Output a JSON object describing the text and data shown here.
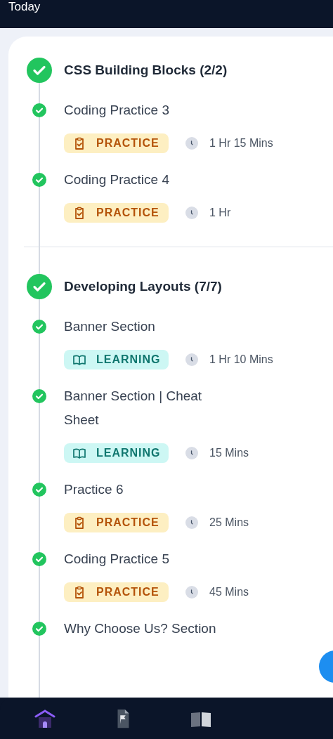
{
  "header": {
    "title": "Today"
  },
  "sections": [
    {
      "title": "CSS Building Blocks (2/2)",
      "completed": true,
      "items": [
        {
          "title": "Coding Practice 3",
          "completed": true,
          "kind": "practice",
          "tag": "PRACTICE",
          "duration": "1 Hr 15 Mins"
        },
        {
          "title": "Coding Practice 4",
          "completed": true,
          "kind": "practice",
          "tag": "PRACTICE",
          "duration": "1 Hr"
        }
      ]
    },
    {
      "title": "Developing Layouts (7/7)",
      "completed": true,
      "items": [
        {
          "title": "Banner Section",
          "completed": true,
          "kind": "learning",
          "tag": "LEARNING",
          "duration": "1 Hr 10 Mins"
        },
        {
          "title": "Banner Section | Cheat Sheet",
          "completed": true,
          "kind": "learning",
          "tag": "LEARNING",
          "duration": "15 Mins"
        },
        {
          "title": "Practice 6",
          "completed": true,
          "kind": "practice",
          "tag": "PRACTICE",
          "duration": "25 Mins"
        },
        {
          "title": "Coding Practice 5",
          "completed": true,
          "kind": "practice",
          "tag": "PRACTICE",
          "duration": "45 Mins"
        },
        {
          "title": "Why Choose Us? Section",
          "completed": true
        }
      ]
    }
  ],
  "nav": [
    {
      "kind": "home",
      "selected": true
    },
    {
      "kind": "flag",
      "selected": false
    },
    {
      "kind": "book",
      "selected": false
    }
  ]
}
